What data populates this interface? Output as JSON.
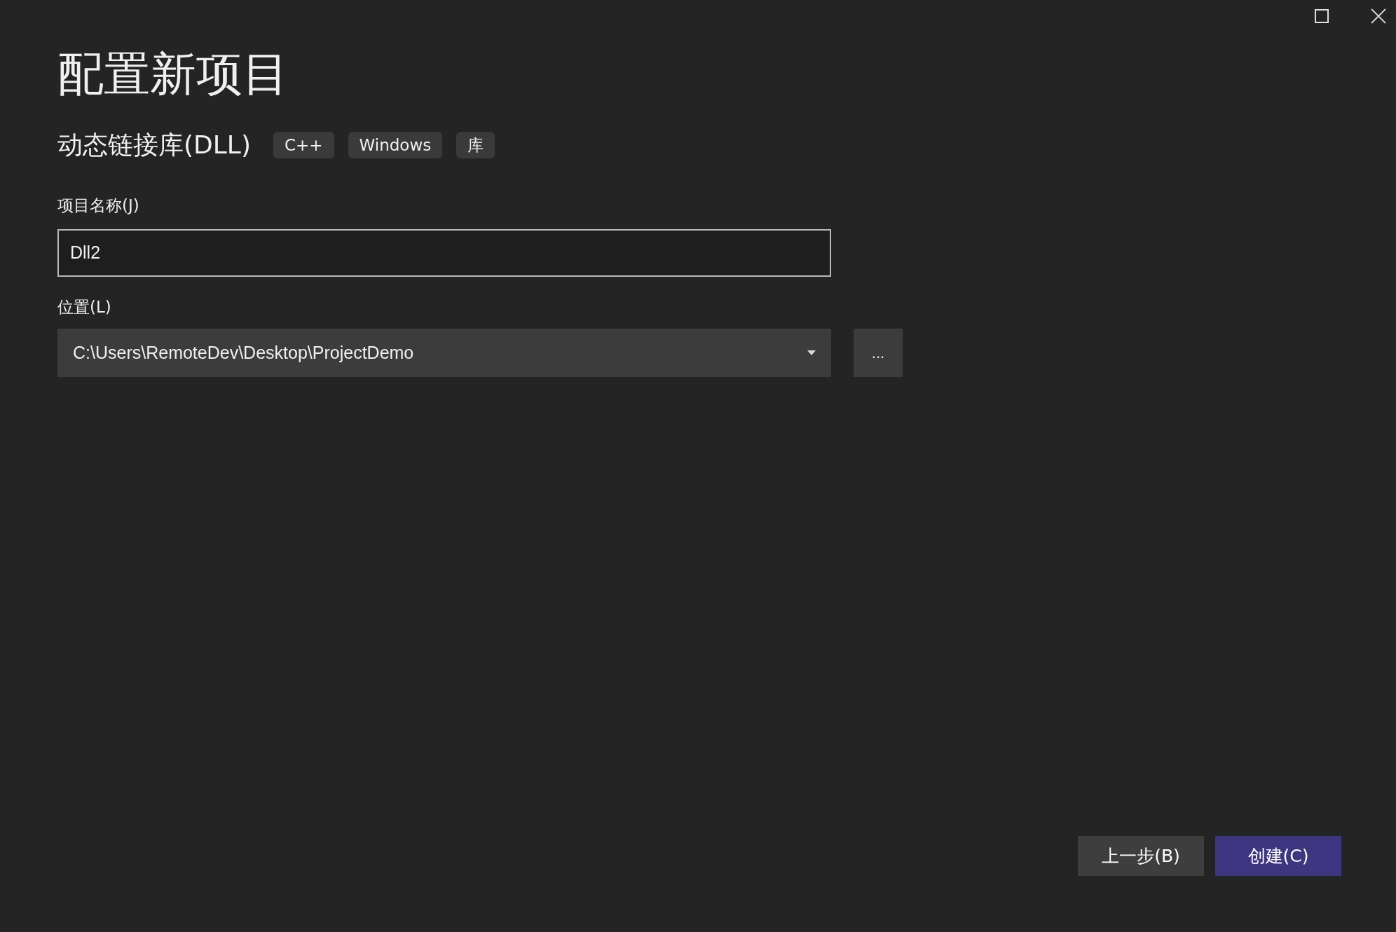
{
  "title": "配置新项目",
  "template": {
    "name": "动态链接库(DLL)",
    "tags": [
      "C++",
      "Windows",
      "库"
    ]
  },
  "project_name": {
    "label": "项目名称(J)",
    "value": "Dll2"
  },
  "location": {
    "label": "位置(L)",
    "value": "C:\\Users\\RemoteDev\\Desktop\\ProjectDemo",
    "browse": "..."
  },
  "buttons": [
    {
      "label": "上一步(B)",
      "kind": "secondary"
    },
    {
      "label": "创建(C)",
      "kind": "primary"
    }
  ]
}
